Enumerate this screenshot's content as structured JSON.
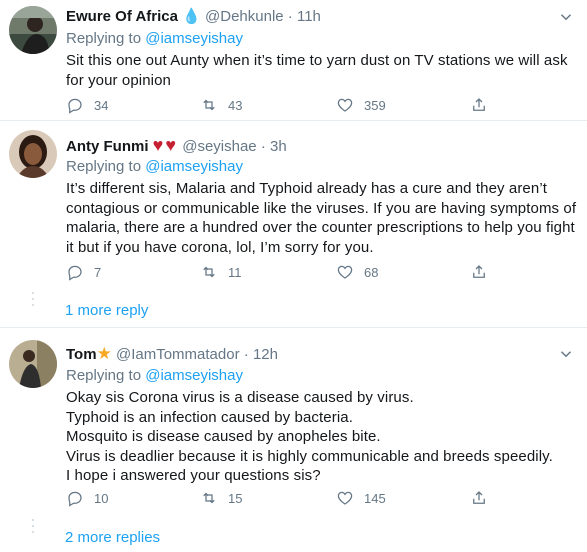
{
  "tweets": [
    {
      "name": "Ewure Of Africa",
      "name_emoji": "💧",
      "handle": "@Dehkunle",
      "time": "11h",
      "replying_prefix": "Replying to",
      "replying_to": "@iamseyishay",
      "text": "Sit this one out Aunty when it’s time to  yarn dust on TV stations we will ask for your opinion",
      "reply_count": "34",
      "retweet_count": "43",
      "like_count": "359"
    },
    {
      "name": "Anty Funmi",
      "name_emoji": "♥♥",
      "handle": "@seyishae",
      "time": "3h",
      "replying_prefix": "Replying to",
      "replying_to": "@iamseyishay",
      "text": "It’s different sis, Malaria and Typhoid already has a cure and they aren’t contagious or communicable like the viruses.  If you are having symptoms of malaria, there are a hundred over the counter prescriptions to help you fight it but if you have corona, lol, I’m sorry for you.",
      "reply_count": "7",
      "retweet_count": "11",
      "like_count": "68",
      "more_replies": "1 more reply"
    },
    {
      "name": "Tom",
      "name_emoji": "★",
      "handle": "@IamTommatador",
      "time": "12h",
      "replying_prefix": "Replying to",
      "replying_to": "@iamseyishay",
      "lines": [
        "Okay sis Corona virus is a disease caused by virus.",
        "Typhoid is an infection caused by bacteria.",
        "Mosquito is disease caused by anopheles bite.",
        "Virus is deadlier because it is highly communicable and breeds speedily.",
        "I hope i answered your questions sis?"
      ],
      "reply_count": "10",
      "retweet_count": "15",
      "like_count": "145",
      "more_replies": "2 more replies"
    }
  ],
  "colors": {
    "accent": "#1da1f2",
    "secondary_text": "#657786",
    "border": "#e6ecf0",
    "heart_red": "#c62033",
    "star_orange": "#f7a825"
  }
}
